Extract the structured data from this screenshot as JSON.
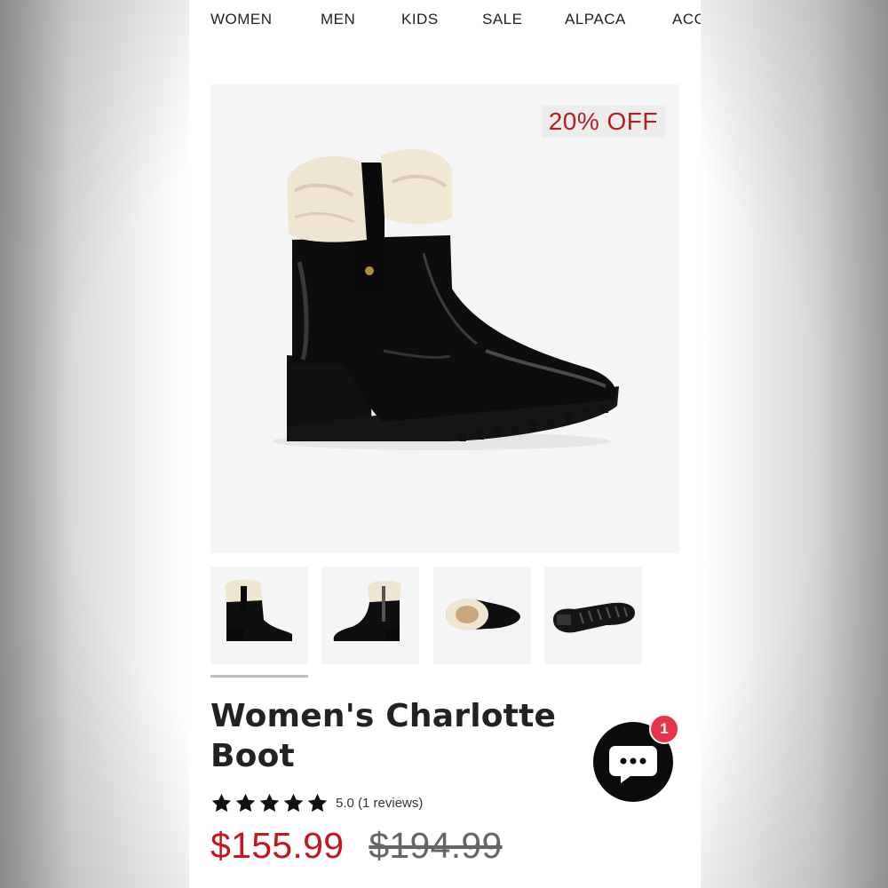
{
  "nav": {
    "items": [
      "WOMEN",
      "MEN",
      "KIDS",
      "SALE",
      "ALPACA",
      "ACC"
    ]
  },
  "hero": {
    "badge": "20% OFF"
  },
  "product": {
    "title": "Women's Charlotte Boot",
    "rating_text": "5.0 (1 reviews)",
    "rating_value": 5,
    "sale_price": "$155.99",
    "original_price": "$194.99"
  },
  "chat": {
    "icon": "chat-bubble-icon",
    "badge_count": "1"
  },
  "colors": {
    "sale_red": "#c4161c",
    "badge_pink": "#e8344a",
    "chat_black": "#0b0b0b"
  }
}
